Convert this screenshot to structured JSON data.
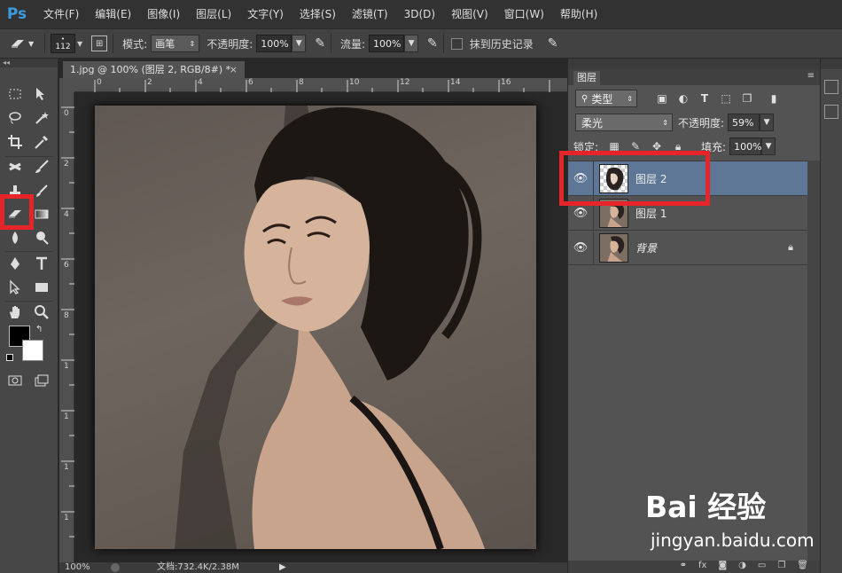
{
  "app": {
    "logo": "Ps"
  },
  "menu": [
    "文件(F)",
    "编辑(E)",
    "图像(I)",
    "图层(L)",
    "文字(Y)",
    "选择(S)",
    "滤镜(T)",
    "3D(D)",
    "视图(V)",
    "窗口(W)",
    "帮助(H)"
  ],
  "options": {
    "brush_size": "112",
    "mode_label": "模式:",
    "mode_value": "画笔",
    "opacity_label": "不透明度:",
    "opacity_value": "100%",
    "flow_label": "流量:",
    "flow_value": "100%",
    "erase_history_label": "抹到历史记录"
  },
  "document": {
    "tab_title": "1.jpg @ 100% (图层 2, RGB/8#) *",
    "zoom": "100%",
    "doc_info": "文档:732.4K/2.38M",
    "ruler_top": [
      "0",
      "2",
      "4",
      "6",
      "8",
      "10",
      "12",
      "14",
      "16"
    ],
    "ruler_left": [
      "0",
      "2",
      "4",
      "6",
      "8",
      "1",
      "1",
      "1",
      "1"
    ]
  },
  "layers_panel": {
    "tab": "图层",
    "filter_label": "类型",
    "blend_mode": "柔光",
    "opacity_label": "不透明度:",
    "opacity_value": "59%",
    "lock_label": "锁定:",
    "fill_label": "填充:",
    "fill_value": "100%",
    "layers": [
      {
        "name": "图层 2",
        "selected": true
      },
      {
        "name": "图层 1",
        "selected": false
      },
      {
        "name": "背景",
        "selected": false,
        "locked": true
      }
    ]
  },
  "watermark": {
    "logo": "Bai 经验",
    "url": "jingyan.baidu.com"
  },
  "colors": {
    "highlight": "#e8242b",
    "selected_layer": "#5e7796",
    "ps_blue": "#3b9be0"
  }
}
